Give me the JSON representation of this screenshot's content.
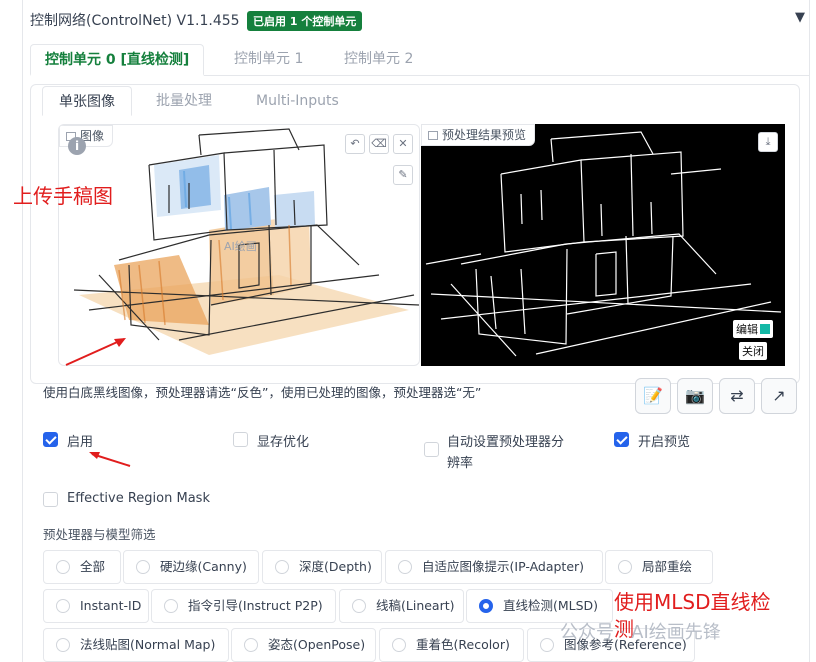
{
  "header": {
    "title": "控制网络(ControlNet) V1.1.455",
    "badge": "已启用 1 个控制单元",
    "collapse_icon": "triangle-down-icon"
  },
  "unit_tabs": [
    {
      "label": "控制单元 0 [直线检测]",
      "active": true
    },
    {
      "label": "控制单元 1",
      "active": false
    },
    {
      "label": "控制单元 2",
      "active": false
    }
  ],
  "image_tabs": [
    {
      "label": "单张图像",
      "active": true
    },
    {
      "label": "批量处理",
      "active": false
    },
    {
      "label": "Multi-Inputs",
      "active": false
    }
  ],
  "left_canvas": {
    "label": "图像",
    "watermark": "AI绘画",
    "tools": [
      "undo-icon",
      "eraser-icon",
      "close-icon",
      "brush-icon"
    ]
  },
  "right_canvas": {
    "label": "预处理结果预览",
    "edit_label": "编辑",
    "close_label": "关闭",
    "download_icon": "download-icon"
  },
  "annotations": {
    "upload": "上传手稿图",
    "mlsd_line1": "使用MLSD直线检",
    "mlsd_line2": "测"
  },
  "hint": "使用白底黑线图像，预处理器请选“反色”，使用已处理的图像，预处理器选“无”",
  "action_buttons": [
    "notes-icon",
    "camera-icon",
    "swap-icon",
    "send-icon"
  ],
  "checkboxes": {
    "enable": {
      "label": "启用",
      "checked": true
    },
    "low_vram": {
      "label": "显存优化",
      "checked": false
    },
    "pixel_perfect_line1": "自动设置预处理器分",
    "pixel_perfect_line2": "辨率",
    "pixel_perfect_checked": false,
    "preview": {
      "label": "开启预览",
      "checked": true
    },
    "region_mask": {
      "label": "Effective Region Mask",
      "checked": false
    }
  },
  "filter_label": "预处理器与模型筛选",
  "filters": [
    {
      "label": "全部",
      "selected": false
    },
    {
      "label": "硬边缘(Canny)",
      "selected": false
    },
    {
      "label": "深度(Depth)",
      "selected": false
    },
    {
      "label": "自适应图像提示(IP-Adapter)",
      "selected": false
    },
    {
      "label": "局部重绘",
      "selected": false
    },
    {
      "label": "Instant-ID",
      "selected": false
    },
    {
      "label": "指令引导(Instruct P2P)",
      "selected": false
    },
    {
      "label": "线稿(Lineart)",
      "selected": false
    },
    {
      "label": "直线检测(MLSD)",
      "selected": true
    },
    {
      "label": "法线贴图(Normal Map)",
      "selected": false
    },
    {
      "label": "姿态(OpenPose)",
      "selected": false
    },
    {
      "label": "重着色(Recolor)",
      "selected": false
    },
    {
      "label": "图像参考(Reference)",
      "selected": false
    }
  ],
  "watermark": "公众号 · AI绘画先锋",
  "colors": {
    "accent_green": "#15803d",
    "accent_blue": "#2563eb",
    "annotation_red": "#e11d1d"
  }
}
